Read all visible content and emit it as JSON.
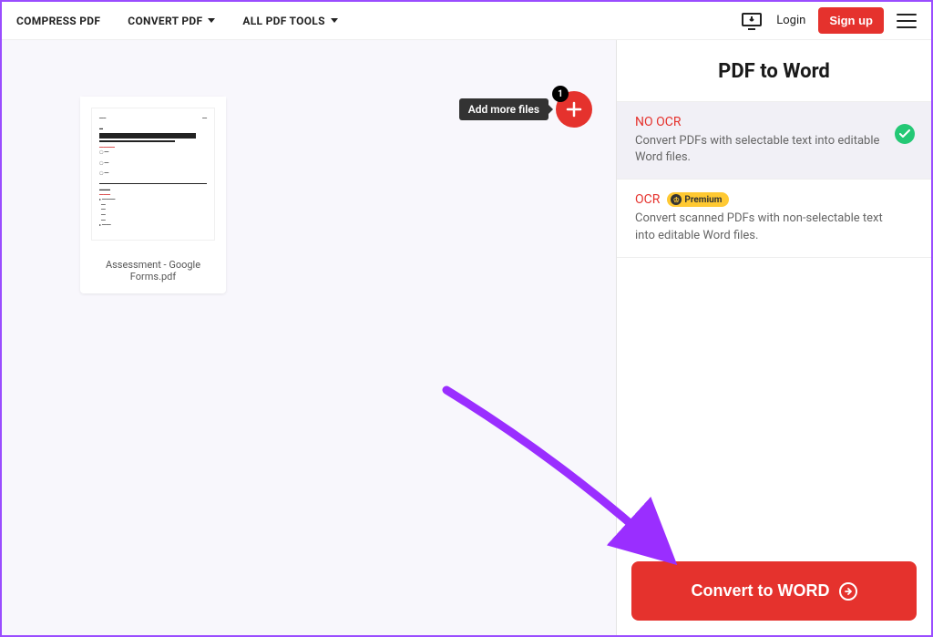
{
  "nav": {
    "compress": "COMPRESS PDF",
    "convert": "CONVERT PDF",
    "all_tools": "ALL PDF TOOLS",
    "login": "Login",
    "signup": "Sign up"
  },
  "canvas": {
    "file_name": "Assessment - Google Forms.pdf",
    "add_tooltip": "Add more files",
    "badge_count": "1"
  },
  "sidebar": {
    "title": "PDF to Word",
    "options": [
      {
        "title": "NO OCR",
        "desc": "Convert PDFs with selectable text into editable Word files.",
        "selected": true
      },
      {
        "title": "OCR",
        "premium": "Premium",
        "desc": "Convert scanned PDFs with non-selectable text into editable Word files.",
        "selected": false
      }
    ],
    "convert_button": "Convert to WORD"
  }
}
